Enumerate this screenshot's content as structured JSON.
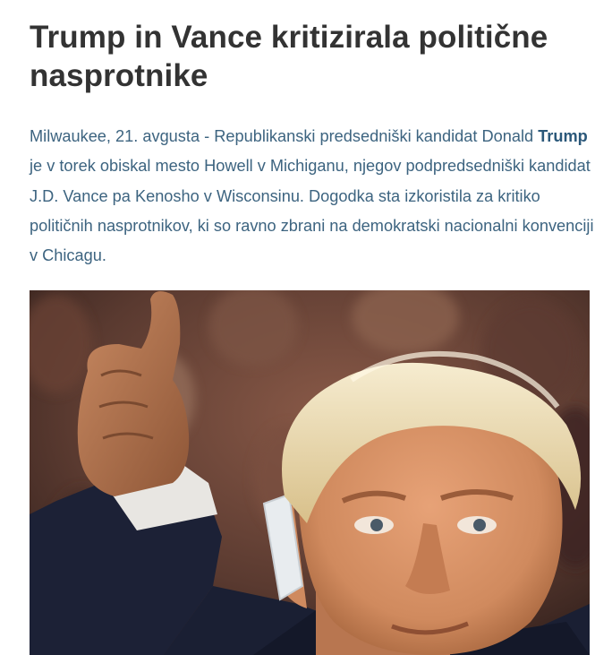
{
  "article": {
    "headline": "Trump in Vance kritizirala politične nasprotnike",
    "lead_before": "Milwaukee, 21. avgusta - Republikanski predsedniški kandidat Donald ",
    "lead_keyword": "Trump",
    "lead_after": " je v torek obiskal mesto Howell v Michiganu, njegov podpredsedniški kandidat J.D. Vance pa Kenosho v Wisconsinu. Dogodka sta izkoristila za kritiko političnih nasprotnikov, ki so ravno zbrani na demokratski nacionalni konvenciji v Chicagu."
  },
  "photo": {
    "icon": "news-photo",
    "colors": {
      "background_dark": "#3a2621",
      "background_warm": "#7a4a3a",
      "skin": "#d9966a",
      "skin_shadow": "#b06f4a",
      "hair": "#ecdcb0",
      "suit": "#1a1f33",
      "bandage": "#e8ecef"
    }
  },
  "theme": {
    "headline_color": "#333333",
    "lead_color": "#3d6480",
    "keyword_color": "#2b587a"
  }
}
